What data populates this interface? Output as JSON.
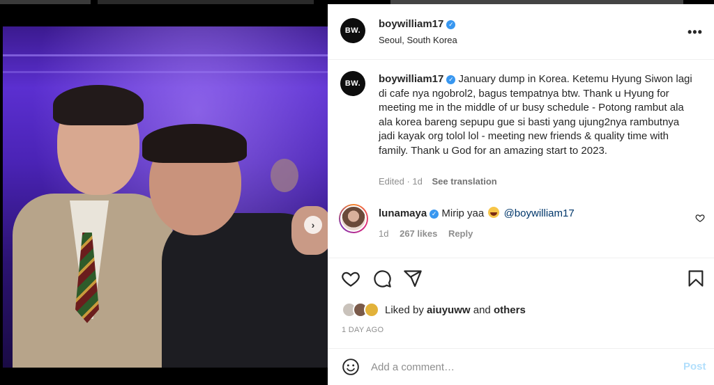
{
  "post": {
    "author": "boywilliam17",
    "author_avatar_text": "BW.",
    "location": "Seoul, South Korea",
    "more_label": "•••",
    "caption_text": "January dump in Korea. Ketemu Hyung Siwon lagi di cafe nya ngobrol2, bagus tempatnya btw. Thank u Hyung for meeting me in the middle of ur busy schedule - Potong rambut ala ala korea bareng sepupu gue si basti yang ujung2nya rambutnya jadi kayak org tolol lol - meeting new friends & quality time with family. Thank u God for an amazing start to 2023.",
    "caption_meta": "Edited · 1d",
    "see_translation": "See translation",
    "carousel_next": "›"
  },
  "comment": {
    "author": "lunamaya",
    "text": "Mirip yaa",
    "mention": "@boywilliam17",
    "time": "1d",
    "likes": "267 likes",
    "reply": "Reply"
  },
  "likes": {
    "prefix": "Liked by",
    "user": "aiuyuww",
    "joiner": "and",
    "others": "others"
  },
  "timestamp": "1 DAY AGO",
  "add_comment": {
    "placeholder": "Add a comment…",
    "post_label": "Post"
  },
  "icons": [
    "more-icon",
    "verified-icon",
    "next-icon",
    "heart-icon",
    "comment-icon",
    "share-icon",
    "bookmark-icon",
    "emoji-icon",
    "laugh-emoji-icon"
  ],
  "colors": {
    "verified": "#3897f0",
    "mention": "#00376b",
    "post_disabled": "#b2dffc",
    "muted": "#8e8e8e"
  }
}
